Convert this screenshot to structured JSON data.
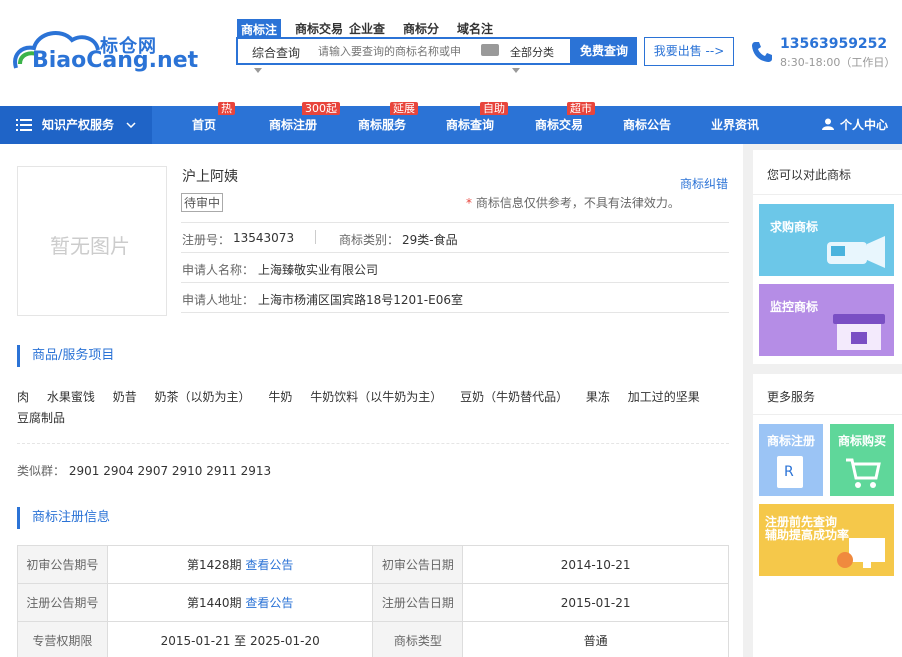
{
  "header": {
    "logo_cn": "标仓网",
    "logo_en": "BiaoCang.net",
    "search_tabs": [
      "商标注",
      "商标交易",
      "企业查",
      "商标分",
      "域名注"
    ],
    "search_mode": "综合查询",
    "search_placeholder": "请输入要查询的商标名称或申",
    "category_select": "全部分类",
    "search_button": "免费查询",
    "sell_button": "我要出售 -->",
    "phone": "13563959252",
    "hours": "8:30-18:00（工作日）"
  },
  "nav": {
    "ip_service": "知识产权服务",
    "items": [
      "首页",
      "商标注册",
      "商标服务",
      "商标查询",
      "商标交易",
      "商标公告",
      "业界资讯"
    ],
    "badges": [
      "热",
      "300起",
      "延展",
      "自助",
      "超市"
    ],
    "user_center": "个人中心"
  },
  "trademark": {
    "no_image": "暂无图片",
    "name": "沪上阿姨",
    "correct_link": "商标纠错",
    "status": "待审中",
    "disclaimer_star": "*",
    "disclaimer": "商标信息仅供参考，不具有法律效力。",
    "reg_no_label": "注册号：",
    "reg_no": "13543073",
    "class_label": "商标类别：",
    "class_value": "29类-食品",
    "applicant_label": "申请人名称：",
    "applicant": "上海臻敬实业有限公司",
    "address_label": "申请人地址：",
    "address": "上海市杨浦区国宾路18号1201-E06室"
  },
  "goods": {
    "title": "商品/服务项目",
    "items": [
      "肉",
      "水果蜜饯",
      "奶昔",
      "奶茶（以奶为主）",
      "牛奶",
      "牛奶饮料（以牛奶为主）",
      "豆奶（牛奶替代品）",
      "果冻",
      "加工过的坚果",
      "豆腐制品"
    ],
    "similar_label": "类似群：",
    "similar_groups": "2901 2904 2907 2910 2911 2913"
  },
  "registration": {
    "title": "商标注册信息",
    "rows": [
      {
        "k1": "初审公告期号",
        "v1": "第1428期",
        "l1": "查看公告",
        "k2": "初审公告日期",
        "v2": "2014-10-21"
      },
      {
        "k1": "注册公告期号",
        "v1": "第1440期",
        "l1": "查看公告",
        "k2": "注册公告日期",
        "v2": "2015-01-21"
      },
      {
        "k1": "专营权期限",
        "v1": "2015-01-21 至 2025-01-20",
        "l1": "",
        "k2": "商标类型",
        "v2": "普通"
      }
    ]
  },
  "sidebar": {
    "compare_title": "您可以对此商标",
    "buy": "求购商标",
    "monitor": "监控商标",
    "more_title": "更多服务",
    "reg": "商标注册",
    "purchase": "商标购买",
    "pre_check": "注册前先查询\n辅助提高成功率"
  },
  "colors": {
    "primary": "#2b73d6",
    "badge": "#e8453c"
  }
}
